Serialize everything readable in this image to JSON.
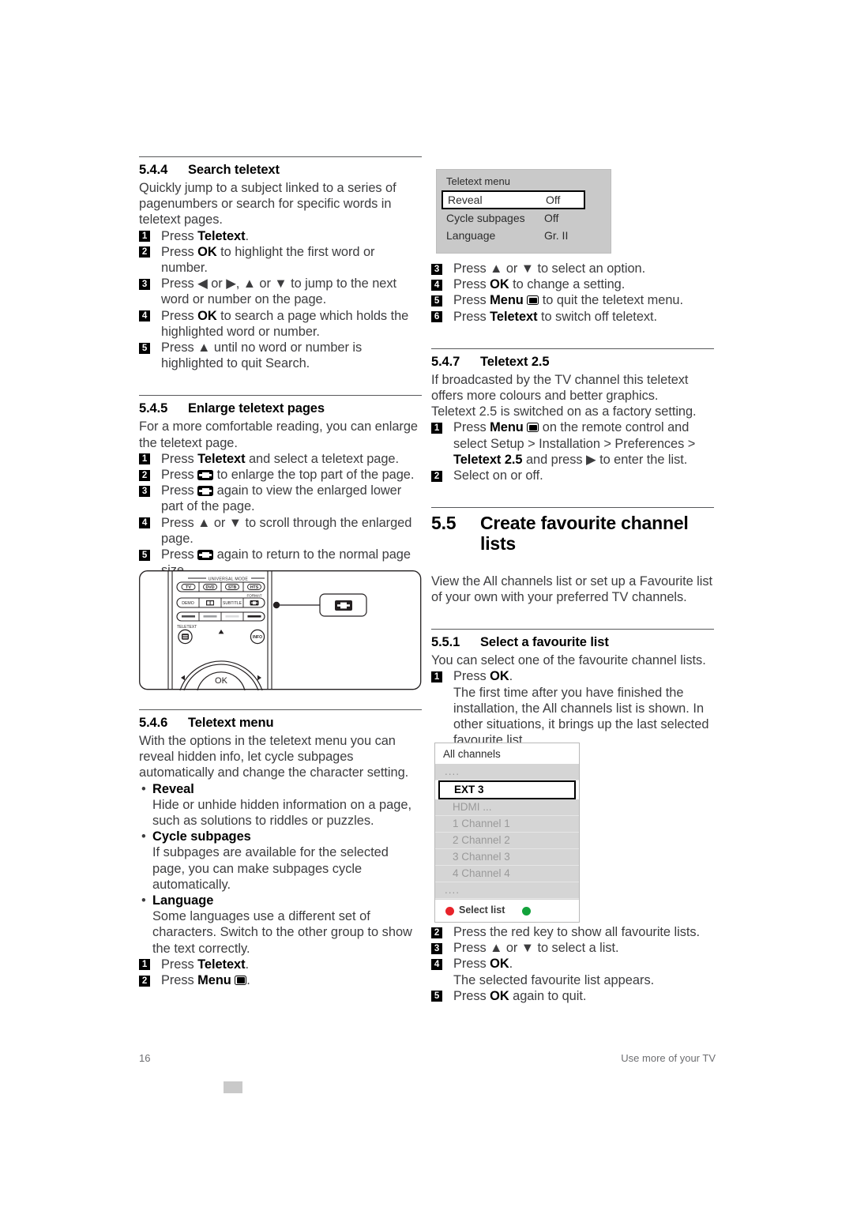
{
  "page": {
    "number": "16",
    "footer_right": "Use more of your TV"
  },
  "sections": {
    "search_teletext": {
      "num": "5.4.4",
      "title": "Search teletext",
      "intro": "Quickly jump to a subject linked to a series of pagenumbers or search for specific words in teletext pages.",
      "steps": [
        {
          "n": "1",
          "pre": "Press ",
          "key": "Teletext",
          "post": "."
        },
        {
          "n": "2",
          "pre": "Press ",
          "key": "OK",
          "post": " to highlight the first word or number."
        },
        {
          "n": "3",
          "text": "Press ◀ or ▶, ▲ or ▼ to jump to the next word or number on the page."
        },
        {
          "n": "4",
          "pre": "Press ",
          "key": "OK",
          "post": " to search a page which holds the highlighted word or number."
        },
        {
          "n": "5",
          "text": "Press ▲ until no word or number is highlighted to quit Search."
        }
      ]
    },
    "enlarge_teletext": {
      "num": "5.4.5",
      "title": "Enlarge teletext pages",
      "intro": "For a more comfortable reading, you can enlarge the teletext page.",
      "steps": [
        {
          "n": "1",
          "pre": "Press ",
          "key": "Teletext",
          "post": " and select a teletext page."
        },
        {
          "n": "2",
          "pre": "Press ",
          "icon": "format-icon",
          "post": " to enlarge the top part of the page."
        },
        {
          "n": "3",
          "pre": "Press ",
          "icon": "format-icon",
          "post": " again to view the enlarged lower part of the page."
        },
        {
          "n": "4",
          "text": "Press ▲ or ▼ to scroll through the enlarged page."
        },
        {
          "n": "5",
          "pre": "Press ",
          "icon": "format-icon",
          "post": " again to return to the normal page size."
        }
      ]
    },
    "teletext_menu": {
      "num": "5.4.6",
      "title": "Teletext menu",
      "intro": "With the options in the teletext menu you can reveal hidden info, let cycle subpages automatically and change the character setting.",
      "bullets": [
        {
          "label": "Reveal",
          "text": "Hide or unhide hidden information on a page, such as solutions to riddles or puzzles."
        },
        {
          "label": "Cycle subpages",
          "text": "If subpages are available for the selected page, you can make subpages cycle automatically."
        },
        {
          "label": "Language",
          "text": "Some languages use a different set of characters. Switch to the other group to show the text correctly."
        }
      ],
      "steps_left": [
        {
          "n": "1",
          "pre": "Press ",
          "key": "Teletext",
          "post": "."
        },
        {
          "n": "2",
          "pre": "Press ",
          "key": "Menu",
          "icon": "menu-icon",
          "post": "."
        }
      ],
      "steps_right": [
        {
          "n": "3",
          "text": "Press ▲ or ▼ to select an option."
        },
        {
          "n": "4",
          "pre": "Press ",
          "key": "OK",
          "post": " to change a setting."
        },
        {
          "n": "5",
          "pre": "Press ",
          "key": "Menu",
          "icon": "menu-icon",
          "post": " to quit the teletext menu."
        },
        {
          "n": "6",
          "pre": "Press ",
          "key": "Teletext",
          "post": " to switch off teletext."
        }
      ]
    },
    "teletext_25": {
      "num": "5.4.7",
      "title": "Teletext 2.5",
      "intro1": "If broadcasted by the TV channel this teletext offers more colours and better graphics.",
      "intro2": "Teletext 2.5 is switched on as a factory setting.",
      "steps": [
        {
          "n": "1",
          "pre": "Press ",
          "key": "Menu",
          "icon": "menu-icon",
          "mid": " on the remote control and select Setup > Installation > Preferences > ",
          "key2": "Teletext 2.5",
          "post": " and press ▶ to enter the list."
        },
        {
          "n": "2",
          "text": "Select on or off."
        }
      ]
    },
    "create_favourite": {
      "num": "5.5",
      "title_line1": "Create favourite channel",
      "title_line2": "lists",
      "intro": "View the All channels list or set up a Favourite list of your own with your preferred TV channels."
    },
    "select_favourite": {
      "num": "5.5.1",
      "title": "Select a favourite list",
      "intro": "You can select one of the favourite channel lists.",
      "steps": [
        {
          "n": "1",
          "pre": "Press ",
          "key": "OK",
          "post": "."
        },
        {
          "sub": "The first time after you have finished the installation, the All channels list is shown. In other situations, it brings up the last selected favourite list."
        }
      ],
      "steps_after": [
        {
          "n": "2",
          "text": "Press the red key to show all favourite lists."
        },
        {
          "n": "3",
          "text": "Press ▲ or ▼ to select a list."
        },
        {
          "n": "4",
          "pre": "Press ",
          "key": "OK",
          "post": "."
        },
        {
          "sub": "The selected favourite list appears."
        },
        {
          "n": "5",
          "pre": "Press ",
          "key": "OK",
          "post": " again to quit."
        }
      ]
    }
  },
  "osd_teletext_menu": {
    "title": "Teletext menu",
    "rows": [
      {
        "label": "Reveal",
        "value": "Off",
        "selected": true
      },
      {
        "label": "Cycle subpages",
        "value": "Off",
        "selected": false
      },
      {
        "label": "Language",
        "value": "Gr. II",
        "selected": false
      }
    ]
  },
  "osd_all_channels": {
    "header": "All channels",
    "rows": [
      {
        "label": "....",
        "selected": false,
        "dots": true
      },
      {
        "label": "EXT 3",
        "selected": true
      },
      {
        "label": "HDMI ...",
        "selected": false
      },
      {
        "label": "1 Channel 1",
        "selected": false
      },
      {
        "label": "2 Channel 2",
        "selected": false
      },
      {
        "label": "3 Channel 3",
        "selected": false
      },
      {
        "label": "4 Channel 4",
        "selected": false
      },
      {
        "label": "....",
        "selected": false,
        "dots": true
      }
    ],
    "footer": {
      "red_label": "Select list",
      "red_color": "#e8232a",
      "green_color": "#12a23b"
    }
  },
  "remote": {
    "universal_mode_label": "UNIVERSAL MODE",
    "mode_buttons": [
      "TV",
      "DVD",
      "STB",
      "HTS"
    ],
    "row2_buttons": [
      "DEMO",
      "",
      "SUBTITLE",
      ""
    ],
    "format_label": "FORMAT",
    "teletext_label": "TELETEXT",
    "info_label": "INFO",
    "ok_label": "OK",
    "callout_icon": "format-icon"
  }
}
